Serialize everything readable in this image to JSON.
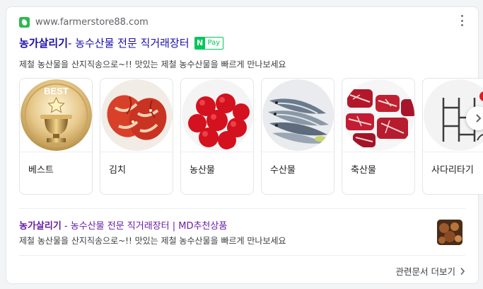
{
  "site": {
    "domain": "www.farmerstore88.com",
    "favicon": "leaf-icon"
  },
  "result": {
    "title_main": "농가살리기",
    "title_rest": " - 농수산물 전문 직거래장터",
    "pay_n": "N",
    "pay_label": "Pay",
    "description": "제철 농산물을 산지직송으로~!! 맛있는 제철 농수산물을 빠르게 만나보세요"
  },
  "categories": [
    {
      "label": "베스트",
      "image": "best-trophy"
    },
    {
      "label": "김치",
      "image": "kimchi"
    },
    {
      "label": "농산물",
      "image": "apples"
    },
    {
      "label": "수산물",
      "image": "fish"
    },
    {
      "label": "축산물",
      "image": "beef"
    },
    {
      "label": "사다리타기",
      "image": "ladder"
    }
  ],
  "badge_text": "BEST",
  "sub_result": {
    "title_main": "농가살리기",
    "title_rest": " - 농수산물 전문 직거래장터 | MD추천상품",
    "description": "제철 농산물을 산지직송으로~!! 맛있는 제철 농수산물을 빠르게 만나보세요"
  },
  "more_label": "관련문서 더보기",
  "colors": {
    "link": "#1a0dab",
    "visited": "#681da8",
    "naverpay": "#03c75a"
  }
}
